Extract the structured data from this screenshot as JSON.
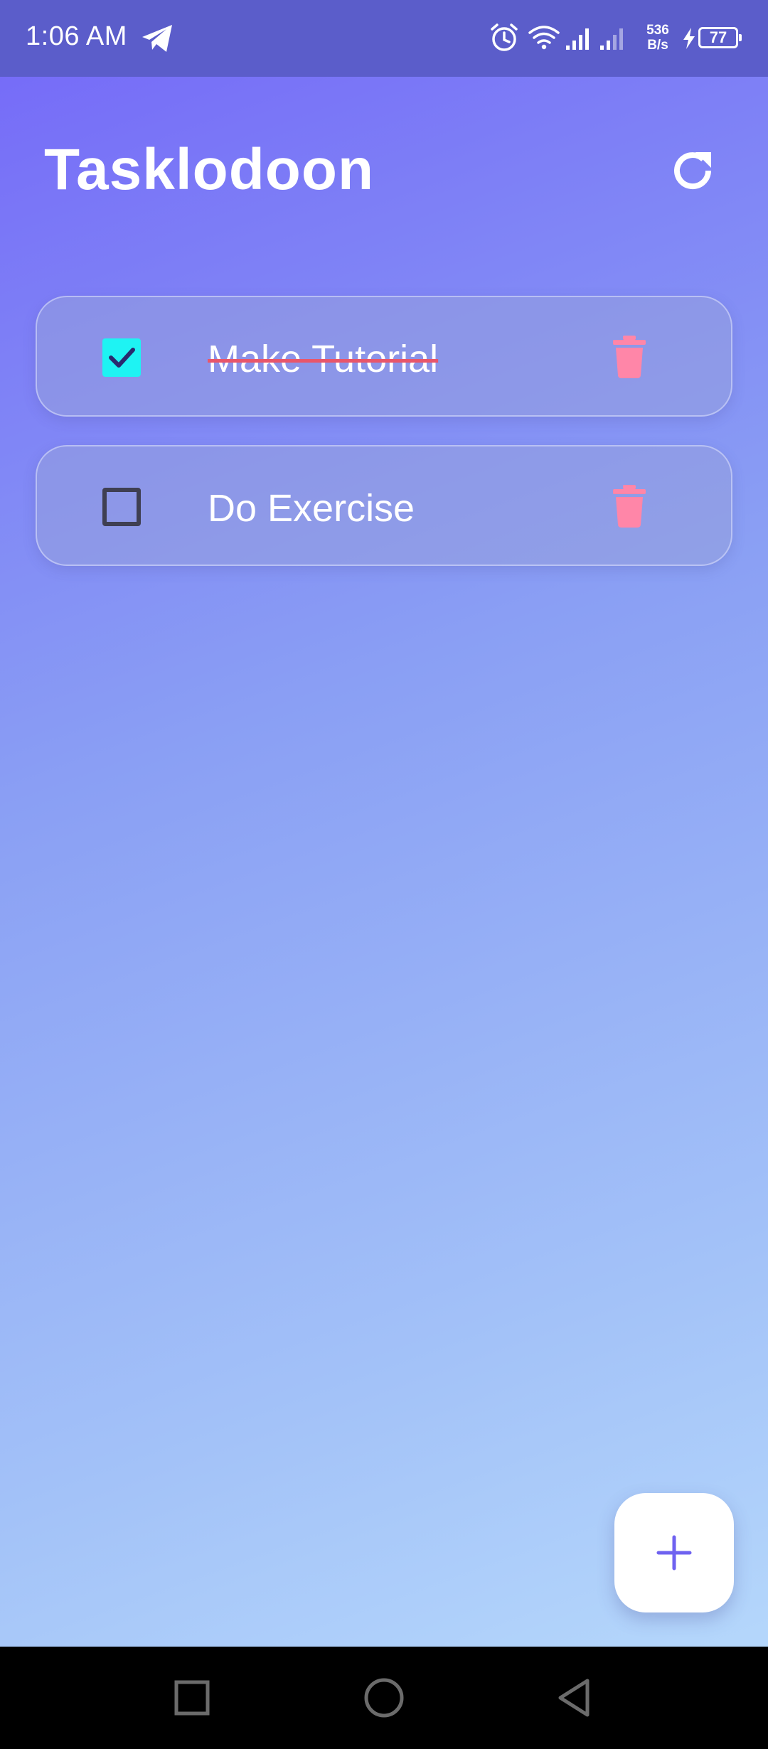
{
  "status_bar": {
    "time": "1:06 AM",
    "net_speed_value": "536",
    "net_speed_unit": "B/s",
    "battery_level": "77",
    "icons": [
      "telegram-icon",
      "alarm-icon",
      "wifi-icon",
      "signal-icon",
      "signal-icon",
      "charging-icon",
      "battery-icon"
    ]
  },
  "header": {
    "title": "Tasklodoon",
    "refresh_icon": "refresh-icon"
  },
  "tasks": [
    {
      "label": "Make Tutorial",
      "completed": true
    },
    {
      "label": "Do Exercise",
      "completed": false
    }
  ],
  "fab": {
    "icon": "plus-icon"
  },
  "nav_bar": {
    "icons": [
      "recent-apps-icon",
      "home-icon",
      "back-icon"
    ]
  },
  "colors": {
    "accent": "#6f62f0",
    "checkbox_checked": "#1ef3f3",
    "delete": "#ff86a8",
    "strike": "#e8566b",
    "status_bar": "#5b5dca"
  }
}
